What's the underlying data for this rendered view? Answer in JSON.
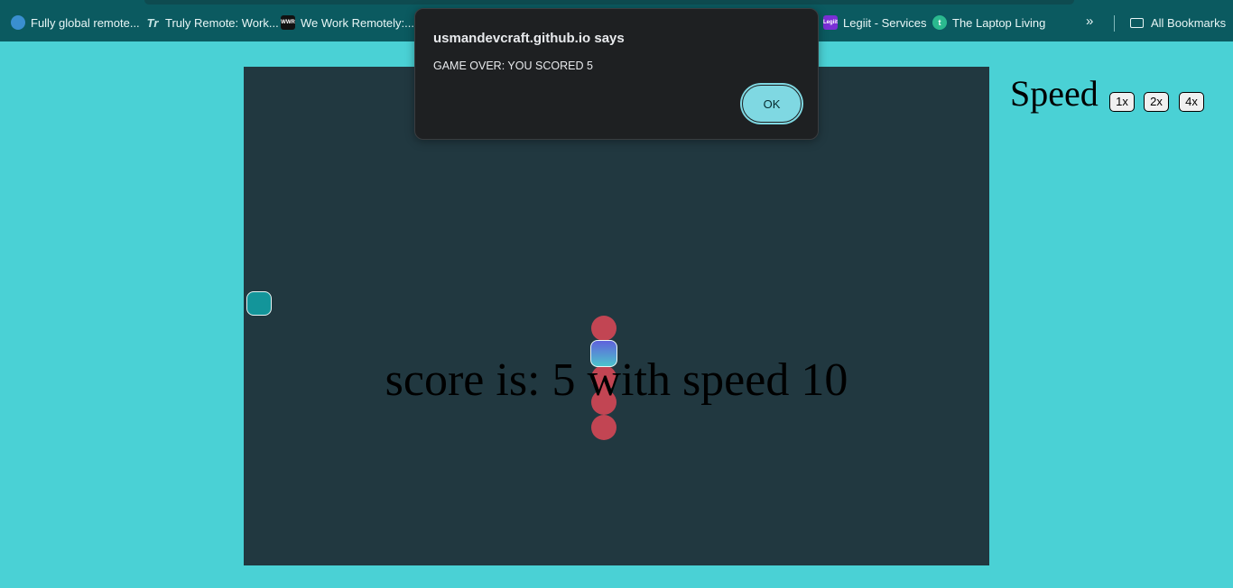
{
  "bookmarks": [
    {
      "icon": "globe-icon",
      "glyph": "",
      "label": "Fully global remote..."
    },
    {
      "icon": "truly-remote-icon",
      "glyph": "Tr",
      "label": "Truly Remote: Work..."
    },
    {
      "icon": "wwr-icon",
      "glyph": "WWR",
      "label": "We Work Remotely:..."
    },
    {
      "icon": "legiit-icon",
      "glyph": "Legiit",
      "label": "Legiit - Services"
    },
    {
      "icon": "laptop-living-icon",
      "glyph": "t",
      "label": "The Laptop Living"
    }
  ],
  "bookmarks_more": "»",
  "all_bookmarks_label": "All Bookmarks",
  "game": {
    "score_text": "score is: 5 with speed 10",
    "score": 5,
    "speed": 10,
    "snake_length": 5,
    "colors": {
      "board": "#213840",
      "snake_body": "#c24553",
      "food": "#13959a",
      "page_background": "#4ad1d5"
    }
  },
  "speed_panel": {
    "label": "Speed",
    "options": [
      "1x",
      "2x",
      "4x"
    ]
  },
  "alert": {
    "title": "usmandevcraft.github.io says",
    "message": "GAME OVER: YOU SCORED 5",
    "ok_label": "OK"
  }
}
